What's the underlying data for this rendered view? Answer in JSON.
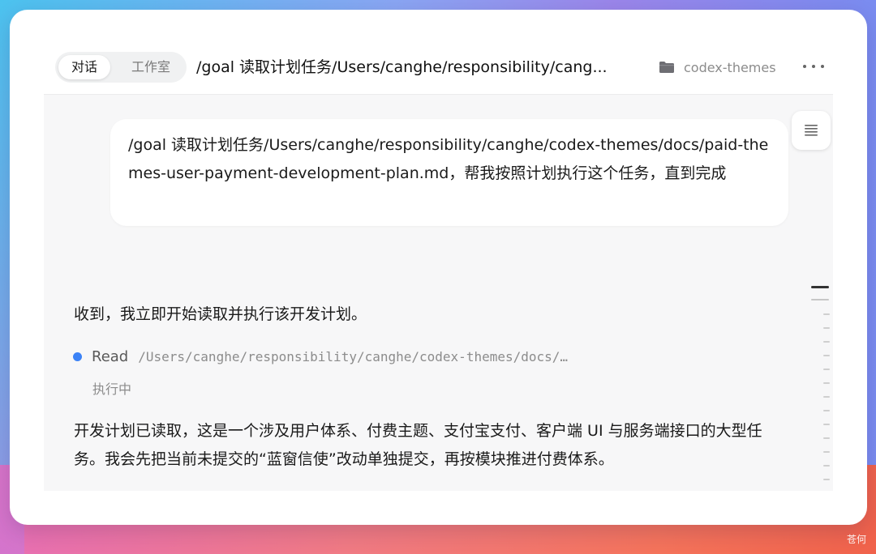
{
  "header": {
    "mode_tabs": [
      "对话",
      "工作室"
    ],
    "title": "/goal 读取计划任务/Users/canghe/responsibility/cang...",
    "project": "codex-themes",
    "project_icon": "folder-icon",
    "more_icon": "more-horizontal-icon"
  },
  "conversation": {
    "user_message": "/goal 读取计划任务/Users/canghe/responsibility/canghe/codex-themes/docs/paid-themes-user-payment-development-plan.md，帮我按照计划执行这个任务，直到完成",
    "assistant_intro": "收到，我立即开始读取并执行该开发计划。",
    "tool_call": {
      "action": "Read",
      "path": "/Users/canghe/responsibility/canghe/codex-themes/docs/…",
      "status": "执行中",
      "status_color": "#3b82f6"
    },
    "assistant_followup": "开发计划已读取，这是一个涉及用户体系、付费主题、支付宝支付、客户端 UI 与服务端接口的大型任务。我会先把当前未提交的“蓝窗信使”改动单独提交，再按模块推进付费体系。"
  },
  "outline_icon": "outline-list-icon",
  "watermark": "苍何"
}
